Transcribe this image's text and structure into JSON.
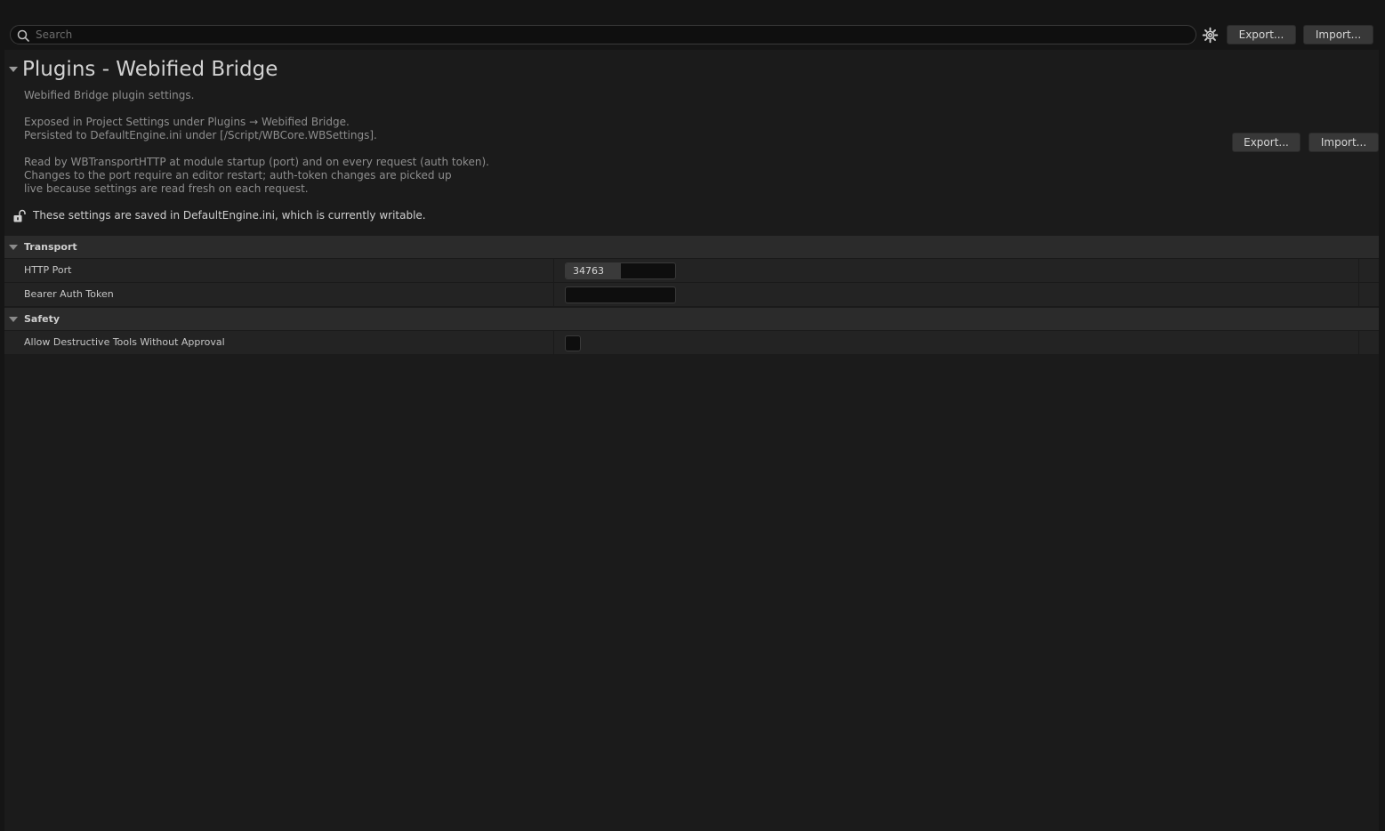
{
  "toolbar": {
    "search_placeholder": "Search",
    "export_label": "Export...",
    "import_label": "Import..."
  },
  "header": {
    "title": "Plugins - Webified Bridge",
    "description_lines": [
      "Webified Bridge plugin settings.",
      "Exposed in Project Settings under Plugins → Webified Bridge.",
      "Persisted to DefaultEngine.ini under [/Script/WBCore.WBSettings].",
      "Read by WBTransportHTTP at module startup (port) and on every request (auth token).",
      "Changes to the port require an editor restart; auth-token changes are picked up",
      "live because settings are read fresh on each request."
    ],
    "export_label": "Export...",
    "import_label": "Import...",
    "save_notice": "These settings are saved in DefaultEngine.ini, which is currently writable."
  },
  "categories": [
    {
      "label": "Transport",
      "properties": [
        {
          "name": "HTTP Port",
          "value": "34763",
          "fill_fraction": 0.5
        },
        {
          "name": "Bearer Auth Token",
          "value": ""
        }
      ]
    },
    {
      "label": "Safety",
      "properties": [
        {
          "name": "Allow Destructive Tools Without Approval",
          "checked": false
        }
      ]
    }
  ],
  "colors": {
    "background": "#151515",
    "panel": "#1b1b1b",
    "category_row": "#2b2b2b",
    "property_row": "#232323",
    "button": "#383838"
  },
  "icons": {
    "search": "search-icon",
    "settings": "gear-icon",
    "lock": "unlocked-padlock-icon",
    "expand": "triangle-down-icon"
  }
}
